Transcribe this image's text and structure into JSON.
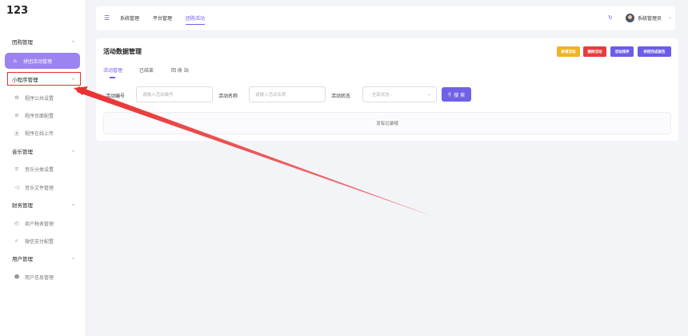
{
  "app": {
    "logo": "123"
  },
  "sidebar": {
    "groups": [
      {
        "label": "团购管理",
        "items": [
          {
            "label": "拼团活动管理",
            "icon": "home-icon",
            "active": true
          }
        ]
      },
      {
        "label": "小程序管理",
        "items": [
          {
            "label": "程序公共设置",
            "icon": "gear-icon"
          },
          {
            "label": "程序页面配置",
            "icon": "compass-icon"
          },
          {
            "label": "程序在线上传",
            "icon": "upload-icon"
          }
        ]
      },
      {
        "label": "音乐管理",
        "items": [
          {
            "label": "音乐分类设置",
            "icon": "list-icon"
          },
          {
            "label": "音乐文件管理",
            "icon": "speaker-icon"
          }
        ]
      },
      {
        "label": "财务管理",
        "items": [
          {
            "label": "商户税表管理",
            "icon": "clock-icon"
          },
          {
            "label": "微信支付配置",
            "icon": "check-circle-icon"
          }
        ]
      },
      {
        "label": "用户管理",
        "items": [
          {
            "label": "用户信息管理",
            "icon": "user-icon"
          }
        ]
      }
    ]
  },
  "topbar": {
    "nav": [
      "系统管理",
      "平台管理",
      "团购活动"
    ],
    "active_nav": "团购活动",
    "username": "系统管理员"
  },
  "main": {
    "title": "活动数据管理",
    "buttons": [
      {
        "label": "新增活动",
        "color": "#f0b429"
      },
      {
        "label": "删除活动",
        "color": "#e53e3e"
      },
      {
        "label": "活动排序",
        "color": "#6c5ce7"
      },
      {
        "label": "拼团完成报告",
        "color": "#6c5ce7"
      }
    ],
    "tabs": [
      "活动管理",
      "已结束",
      "回 收 站"
    ],
    "form": {
      "code_label": "活动编号",
      "code_placeholder": "请输入活动编号",
      "name_label": "活动名称",
      "name_placeholder": "请输入活动名称",
      "status_label": "活动状态",
      "status_value": "- 全部状态 -",
      "search_label": "搜 索"
    },
    "empty_text": "没有记录哦"
  }
}
